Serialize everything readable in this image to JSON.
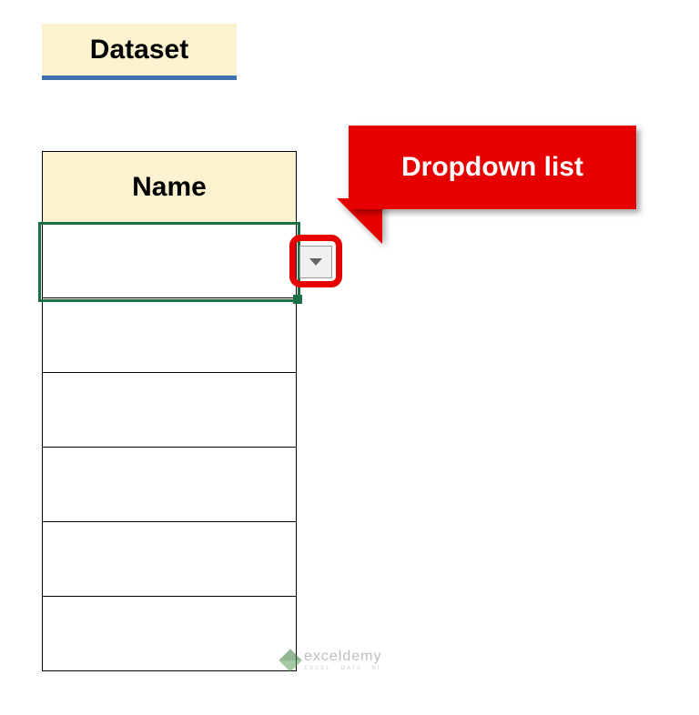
{
  "heading": "Dataset",
  "table": {
    "header": "Name",
    "rows": [
      "",
      "",
      "",
      "",
      "",
      ""
    ]
  },
  "callout": {
    "label": "Dropdown list"
  },
  "watermark": {
    "brand": "exceldemy",
    "tagline": "EXCEL · DATA · BI"
  }
}
